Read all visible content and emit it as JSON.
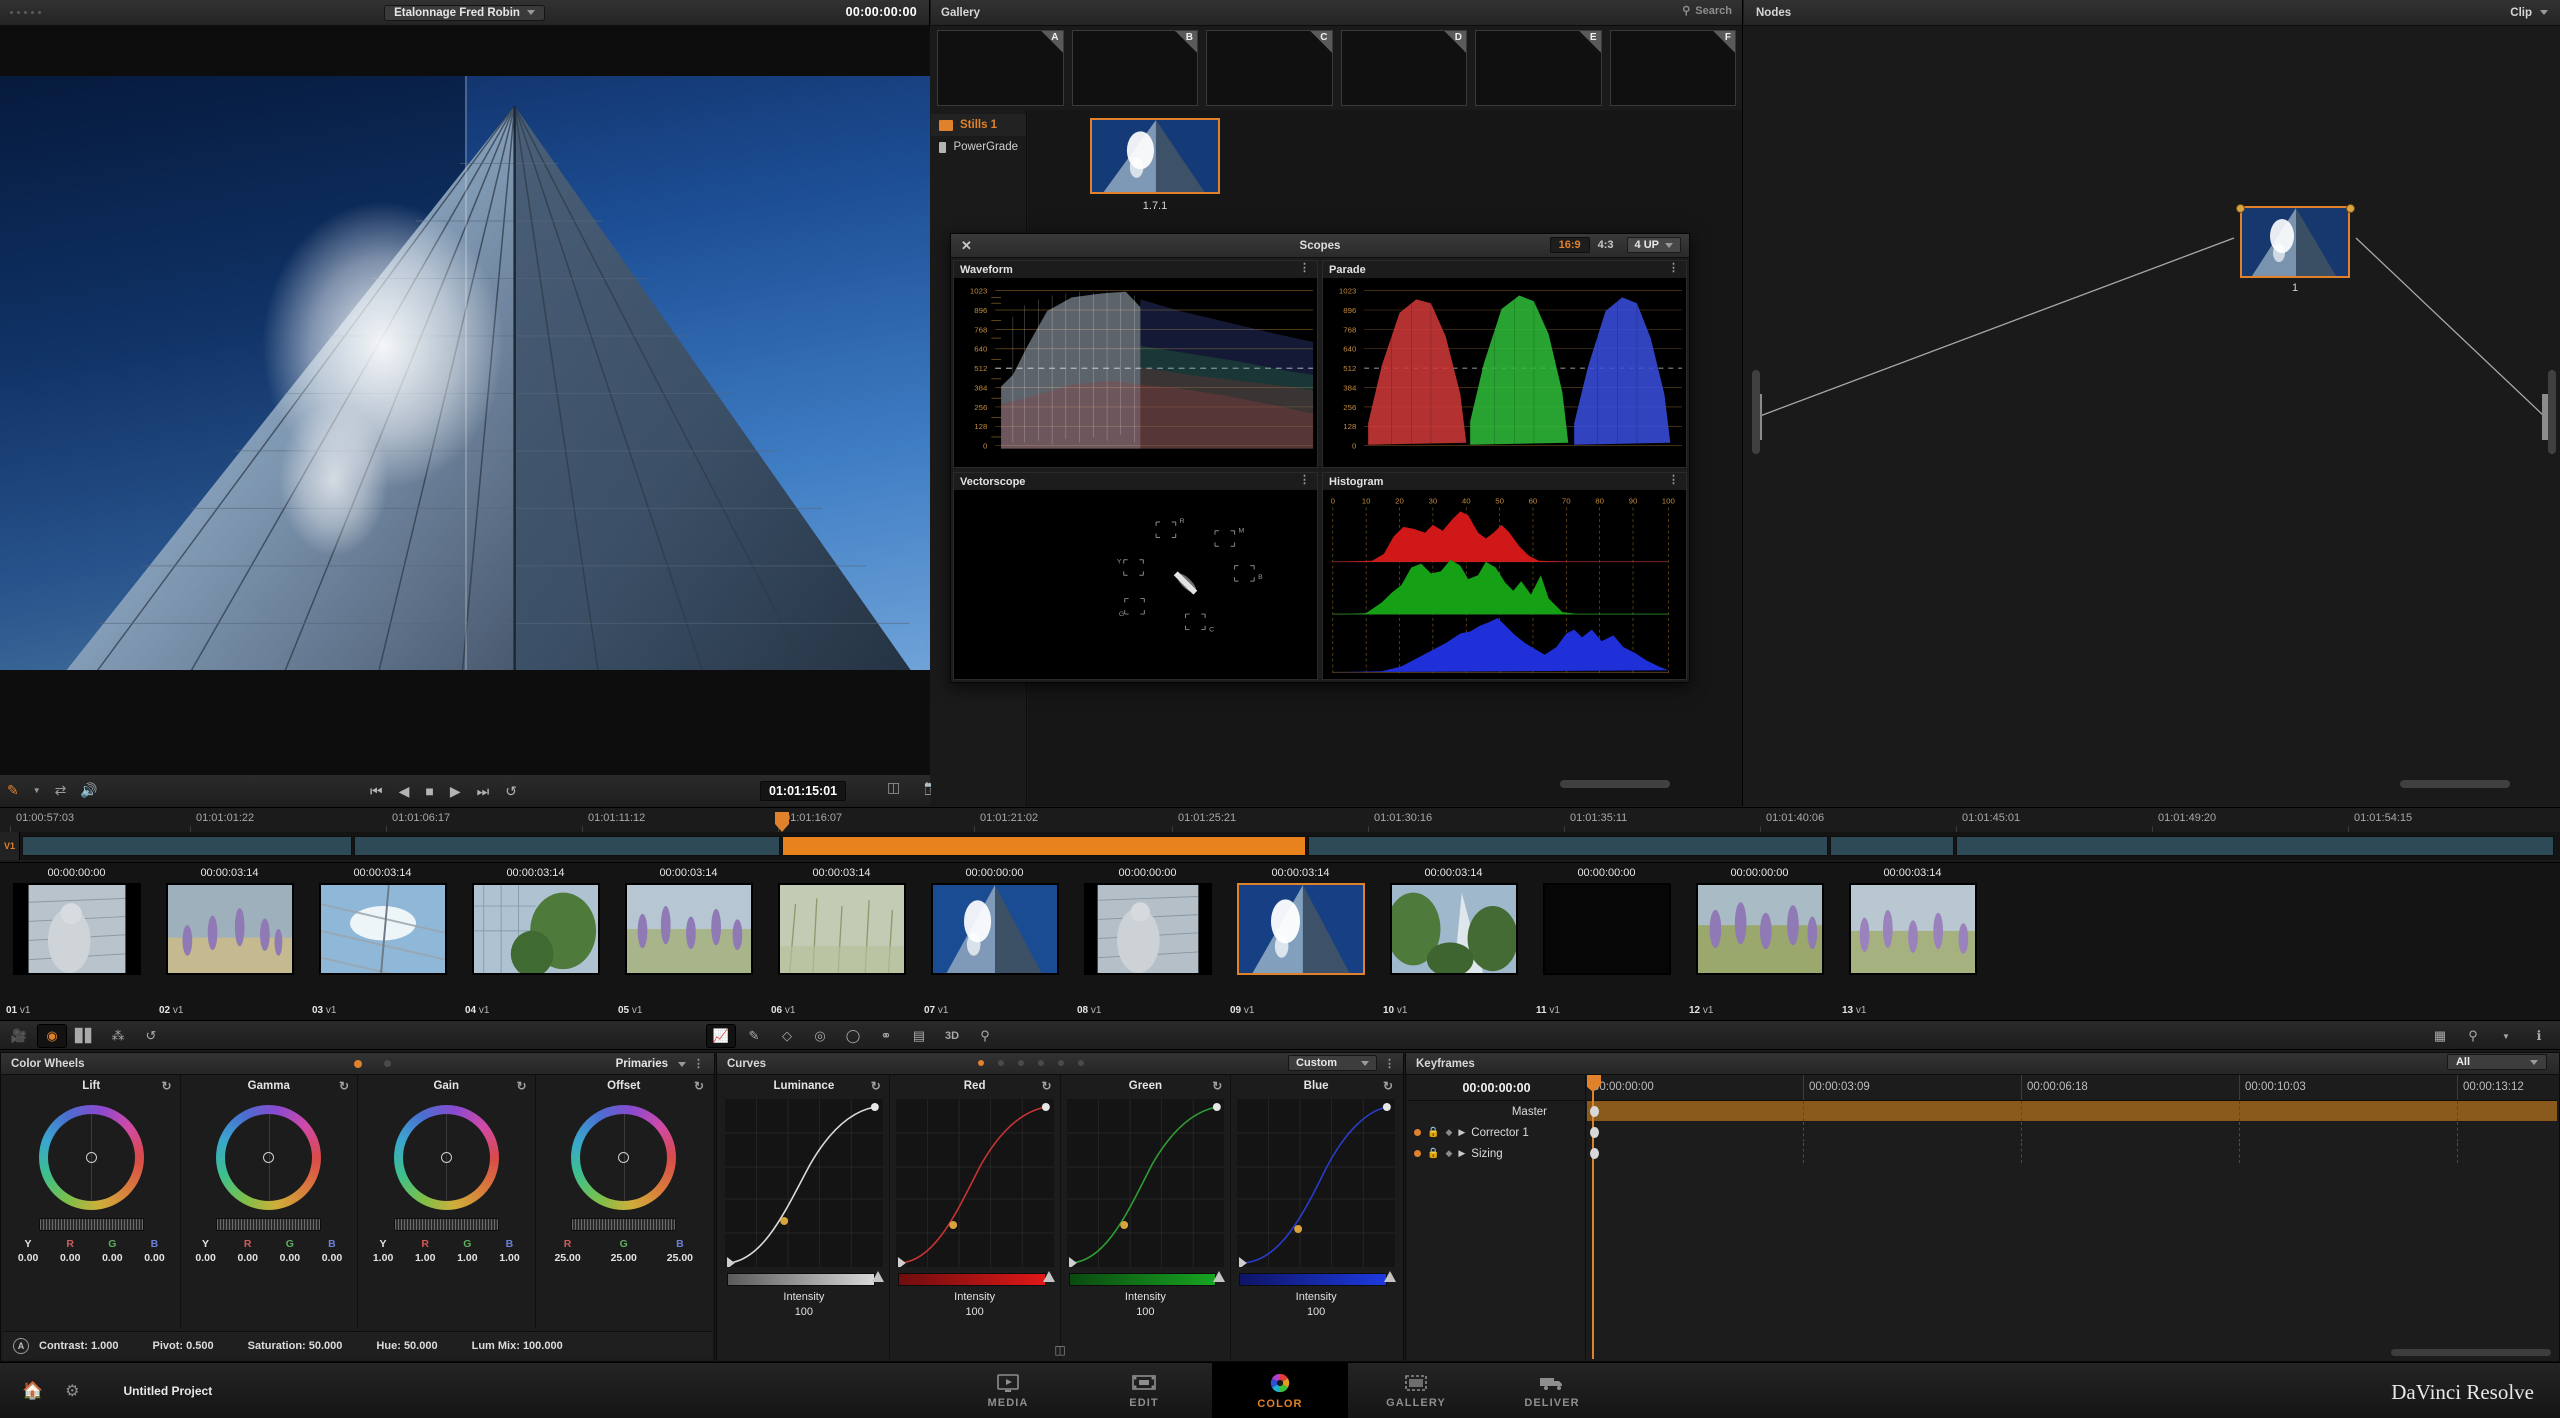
{
  "viewer": {
    "title": "Etalonnage Fred Robin",
    "timecode": "00:00:00:00",
    "current_tc": "01:01:15:01",
    "icons": {
      "picker": "eyedropper-icon",
      "shuffle": "shuffle-icon",
      "audio": "speaker-icon",
      "first": "skip-to-start-icon",
      "rev": "play-reverse-icon",
      "stop": "stop-icon",
      "play": "play-icon",
      "last": "skip-to-end-icon",
      "loop": "loop-icon",
      "split": "split-screen-icon",
      "still": "grab-still-icon"
    }
  },
  "gallery": {
    "title": "Gallery",
    "search_placeholder": "Search",
    "slots": [
      "A",
      "B",
      "C",
      "D",
      "E",
      "F"
    ],
    "folders": [
      {
        "label": "Stills 1",
        "selected": true
      },
      {
        "label": "PowerGrade",
        "selected": false
      }
    ],
    "still_label": "1.7.1"
  },
  "scopes": {
    "title": "Scopes",
    "ratios": [
      {
        "label": "16:9",
        "active": true
      },
      {
        "label": "4:3",
        "active": false
      }
    ],
    "layout": "4 UP",
    "panels": [
      {
        "name": "Waveform",
        "axis": [
          "1023",
          "896",
          "768",
          "640",
          "512",
          "384",
          "256",
          "128",
          "0"
        ]
      },
      {
        "name": "Parade",
        "axis": [
          "1023",
          "896",
          "768",
          "640",
          "512",
          "384",
          "256",
          "128",
          "0"
        ]
      },
      {
        "name": "Vectorscope",
        "targets": [
          "R",
          "M",
          "B",
          "Y",
          "C",
          "G"
        ]
      },
      {
        "name": "Histogram",
        "axis": [
          "0",
          "10",
          "20",
          "30",
          "40",
          "50",
          "60",
          "70",
          "80",
          "90",
          "100"
        ]
      }
    ]
  },
  "nodes": {
    "title": "Nodes",
    "mode": "Clip",
    "node_number": "1"
  },
  "timeline": {
    "ruler_ticks": [
      "01:00:57:03",
      "01:01:01:22",
      "01:01:06:17",
      "01:01:11:12",
      "01:01:16:07",
      "01:01:21:02",
      "01:01:25:21",
      "01:01:30:16",
      "01:01:35:11",
      "01:01:40:06",
      "01:01:45:01",
      "01:01:49:20",
      "01:01:54:15"
    ],
    "track_label": "V1"
  },
  "filmstrip": {
    "clips": [
      {
        "num": "01",
        "track": "v1",
        "tc": "00:00:00:00",
        "selected": false
      },
      {
        "num": "02",
        "track": "v1",
        "tc": "00:00:03:14",
        "selected": false
      },
      {
        "num": "03",
        "track": "v1",
        "tc": "00:00:03:14",
        "selected": false
      },
      {
        "num": "04",
        "track": "v1",
        "tc": "00:00:03:14",
        "selected": false
      },
      {
        "num": "05",
        "track": "v1",
        "tc": "00:00:03:14",
        "selected": false
      },
      {
        "num": "06",
        "track": "v1",
        "tc": "00:00:03:14",
        "selected": false
      },
      {
        "num": "07",
        "track": "v1",
        "tc": "00:00:00:00",
        "selected": false
      },
      {
        "num": "08",
        "track": "v1",
        "tc": "00:00:00:00",
        "selected": false
      },
      {
        "num": "09",
        "track": "v1",
        "tc": "00:00:03:14",
        "selected": true
      },
      {
        "num": "10",
        "track": "v1",
        "tc": "00:00:03:14",
        "selected": false
      },
      {
        "num": "11",
        "track": "v1",
        "tc": "00:00:00:00",
        "selected": false
      },
      {
        "num": "12",
        "track": "v1",
        "tc": "00:00:00:00",
        "selected": false
      },
      {
        "num": "13",
        "track": "v1",
        "tc": "00:00:03:14",
        "selected": false
      }
    ]
  },
  "midbar": {
    "left_icons": [
      "camera-raw-icon",
      "color-wheels-icon",
      "rgb-mixer-icon",
      "motion-effects-icon",
      "curves-icon"
    ],
    "center_icons": [
      "curves-tool-icon",
      "qualifier-icon",
      "power-window-icon",
      "tracker-icon",
      "blur-icon",
      "key-icon",
      "sizing-icon",
      "3D",
      "stereo-icon"
    ],
    "right_icons": [
      "grid-icon",
      "magnifier-icon",
      "info-icon"
    ]
  },
  "color_wheels": {
    "title": "Color Wheels",
    "mode_label": "Primaries",
    "wheels": [
      {
        "name": "Lift",
        "channels": [
          "Y",
          "R",
          "G",
          "B"
        ],
        "values": [
          "0.00",
          "0.00",
          "0.00",
          "0.00"
        ]
      },
      {
        "name": "Gamma",
        "channels": [
          "Y",
          "R",
          "G",
          "B"
        ],
        "values": [
          "0.00",
          "0.00",
          "0.00",
          "0.00"
        ]
      },
      {
        "name": "Gain",
        "channels": [
          "Y",
          "R",
          "G",
          "B"
        ],
        "values": [
          "1.00",
          "1.00",
          "1.00",
          "1.00"
        ]
      },
      {
        "name": "Offset",
        "channels": [
          "R",
          "G",
          "B"
        ],
        "values": [
          "25.00",
          "25.00",
          "25.00"
        ]
      }
    ],
    "footer": [
      {
        "label": "Contrast:",
        "value": "1.000"
      },
      {
        "label": "Pivot:",
        "value": "0.500"
      },
      {
        "label": "Saturation:",
        "value": "50.000"
      },
      {
        "label": "Hue:",
        "value": "50.000"
      },
      {
        "label": "Lum Mix:",
        "value": "100.000"
      }
    ],
    "auto_badge": "A"
  },
  "curves": {
    "title": "Curves",
    "preset": "Custom",
    "channels": [
      {
        "name": "Luminance",
        "intensity_label": "Intensity",
        "intensity": "100",
        "color": "#bfbfbf"
      },
      {
        "name": "Red",
        "intensity_label": "Intensity",
        "intensity": "100",
        "color": "#c02b2b"
      },
      {
        "name": "Green",
        "intensity_label": "Intensity",
        "intensity": "100",
        "color": "#1f8f2b"
      },
      {
        "name": "Blue",
        "intensity_label": "Intensity",
        "intensity": "100",
        "color": "#2233b8"
      }
    ]
  },
  "keyframes": {
    "title": "Keyframes",
    "filter": "All",
    "timecode": "00:00:00:00",
    "tracks": [
      {
        "label": "Master",
        "is_master": true
      },
      {
        "label": "Corrector 1",
        "is_master": false
      },
      {
        "label": "Sizing",
        "is_master": false
      }
    ],
    "ruler": [
      "00:00:00:00",
      "00:00:03:09",
      "00:00:06:18",
      "00:00:10:03",
      "00:00:13:12"
    ]
  },
  "bottombar": {
    "project": "Untitled Project",
    "home_icon": "home-icon",
    "settings_icon": "gear-icon",
    "pages": [
      {
        "label": "MEDIA",
        "active": false,
        "icon": "media-icon"
      },
      {
        "label": "EDIT",
        "active": false,
        "icon": "edit-icon"
      },
      {
        "label": "COLOR",
        "active": true,
        "icon": "color-wheel-icon"
      },
      {
        "label": "GALLERY",
        "active": false,
        "icon": "gallery-icon"
      },
      {
        "label": "DELIVER",
        "active": false,
        "icon": "deliver-truck-icon"
      }
    ],
    "logo": "DaVinci Resolve"
  },
  "colors": {
    "accent": "#e0812c",
    "panel_bg": "#1c1c1c",
    "app_bg": "#1b1b1b"
  },
  "chart_data": [
    {
      "type": "line",
      "title": "Waveform",
      "ylabel": "",
      "yticks": [
        0,
        128,
        256,
        384,
        512,
        640,
        768,
        896,
        1023
      ],
      "ylim": [
        0,
        1023
      ],
      "grid": true,
      "series": [
        {
          "name": "luma",
          "values": [
            390,
            430,
            520,
            640,
            760,
            840,
            900,
            950,
            980,
            960,
            930,
            880,
            820,
            760,
            700,
            650,
            600,
            560,
            520,
            490,
            460,
            440,
            420,
            400
          ]
        }
      ]
    },
    {
      "type": "line",
      "title": "Parade",
      "yticks": [
        0,
        128,
        256,
        384,
        512,
        640,
        768,
        896,
        1023
      ],
      "ylim": [
        0,
        1023
      ],
      "grid": true,
      "series": [
        {
          "name": "Red",
          "values": [
            200,
            320,
            480,
            640,
            760,
            820,
            790,
            700,
            600,
            520,
            460,
            420
          ]
        },
        {
          "name": "Green",
          "values": [
            220,
            360,
            520,
            680,
            800,
            860,
            830,
            740,
            640,
            560,
            490,
            440
          ]
        },
        {
          "name": "Blue",
          "values": [
            260,
            420,
            600,
            760,
            880,
            940,
            910,
            820,
            720,
            630,
            560,
            500
          ]
        }
      ]
    },
    {
      "type": "scatter",
      "title": "Vectorscope",
      "xlabel": "",
      "ylabel": "",
      "annotations": [
        "R",
        "M",
        "B",
        "Y",
        "C",
        "G"
      ]
    },
    {
      "type": "bar",
      "title": "Histogram",
      "xlabel": "",
      "ylabel": "",
      "xticks": [
        0,
        10,
        20,
        30,
        40,
        50,
        60,
        70,
        80,
        90,
        100
      ],
      "xlim": [
        0,
        100
      ],
      "grid": true,
      "series": [
        {
          "name": "Red",
          "values": [
            0,
            0,
            2,
            5,
            30,
            62,
            70,
            58,
            64,
            74,
            52,
            40,
            46,
            28,
            12,
            5,
            2,
            1,
            1,
            1,
            0
          ]
        },
        {
          "name": "Green",
          "values": [
            0,
            1,
            3,
            8,
            26,
            40,
            52,
            68,
            56,
            62,
            72,
            58,
            40,
            34,
            18,
            8,
            4,
            3,
            2,
            1,
            0
          ]
        },
        {
          "name": "Blue",
          "values": [
            0,
            0,
            1,
            2,
            6,
            14,
            26,
            40,
            58,
            66,
            54,
            40,
            32,
            44,
            38,
            26,
            18,
            12,
            6,
            2,
            0
          ]
        }
      ]
    },
    {
      "type": "line",
      "title": "Luminance Curve",
      "xlim": [
        0,
        1
      ],
      "ylim": [
        0,
        1
      ],
      "grid": true,
      "points": [
        [
          0.0,
          0.0
        ],
        [
          0.22,
          0.12
        ],
        [
          0.5,
          0.52
        ],
        [
          0.78,
          0.86
        ],
        [
          1.0,
          1.0
        ]
      ]
    },
    {
      "type": "line",
      "title": "Red Curve",
      "xlim": [
        0,
        1
      ],
      "ylim": [
        0,
        1
      ],
      "grid": true,
      "points": [
        [
          0.0,
          0.0
        ],
        [
          0.25,
          0.1
        ],
        [
          0.5,
          0.5
        ],
        [
          0.75,
          0.88
        ],
        [
          1.0,
          1.0
        ]
      ]
    },
    {
      "type": "line",
      "title": "Green Curve",
      "xlim": [
        0,
        1
      ],
      "ylim": [
        0,
        1
      ],
      "grid": true,
      "points": [
        [
          0.0,
          0.0
        ],
        [
          0.25,
          0.1
        ],
        [
          0.5,
          0.5
        ],
        [
          0.75,
          0.88
        ],
        [
          1.0,
          1.0
        ]
      ]
    },
    {
      "type": "line",
      "title": "Blue Curve",
      "xlim": [
        0,
        1
      ],
      "ylim": [
        0,
        1
      ],
      "grid": true,
      "points": [
        [
          0.0,
          0.0
        ],
        [
          0.25,
          0.08
        ],
        [
          0.5,
          0.46
        ],
        [
          0.75,
          0.86
        ],
        [
          1.0,
          1.0
        ]
      ]
    }
  ]
}
